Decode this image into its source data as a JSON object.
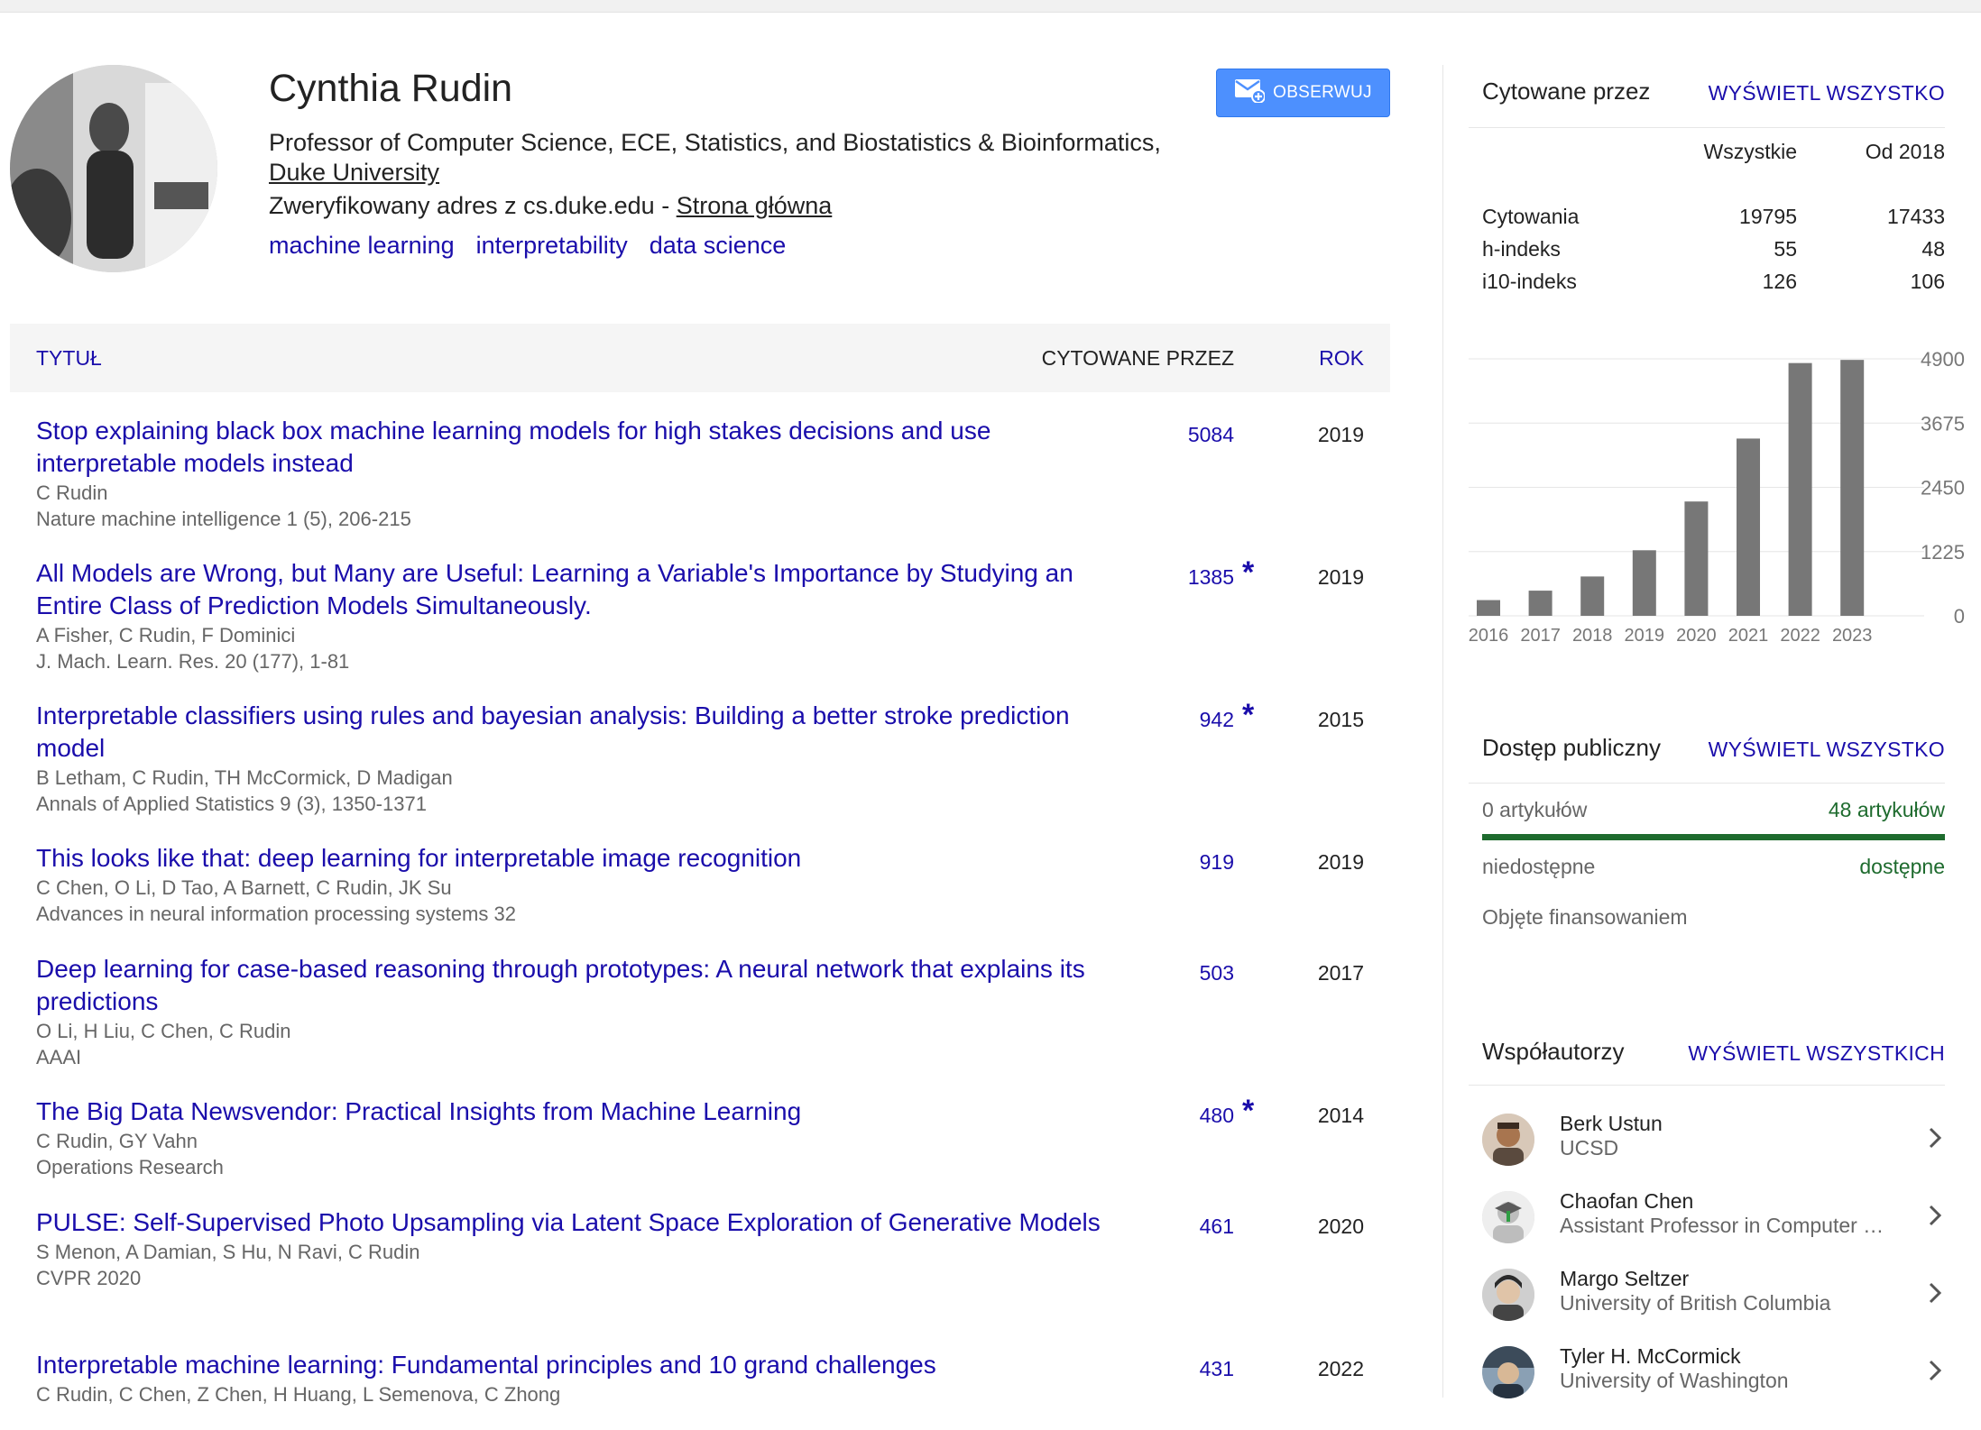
{
  "profile": {
    "name": "Cynthia Rudin",
    "affiliation_prefix": "Professor of Computer Science, ECE, Statistics, and Biostatistics & Bioinformatics,",
    "affiliation_link": "Duke University",
    "verified_text": "Zweryfikowany adres z cs.duke.edu - ",
    "homepage_link": "Strona główna",
    "interests": [
      "machine learning",
      "interpretability",
      "data science"
    ],
    "follow_label": "OBSERWUJ"
  },
  "table": {
    "col_title": "TYTUŁ",
    "col_cited": "CYTOWANE PRZEZ",
    "col_year": "ROK",
    "rows": [
      {
        "title": "Stop explaining black box machine learning models for high stakes decisions and use interpretable models instead",
        "authors": "C Rudin",
        "venue": "Nature machine intelligence 1 (5), 206-215",
        "cited": "5084",
        "star": "",
        "year": "2019"
      },
      {
        "title": "All Models are Wrong, but Many are Useful: Learning a Variable's Importance by Studying an Entire Class of Prediction Models Simultaneously.",
        "authors": "A Fisher, C Rudin, F Dominici",
        "venue": "J. Mach. Learn. Res. 20 (177), 1-81",
        "cited": "1385",
        "star": "*",
        "year": "2019"
      },
      {
        "title": "Interpretable classifiers using rules and bayesian analysis: Building a better stroke prediction model",
        "authors": "B Letham, C Rudin, TH McCormick, D Madigan",
        "venue": "Annals of Applied Statistics 9 (3), 1350-1371",
        "cited": "942",
        "star": "*",
        "year": "2015"
      },
      {
        "title": "This looks like that: deep learning for interpretable image recognition",
        "authors": "C Chen, O Li, D Tao, A Barnett, C Rudin, JK Su",
        "venue": "Advances in neural information processing systems 32",
        "cited": "919",
        "star": "",
        "year": "2019"
      },
      {
        "title": "Deep learning for case-based reasoning through prototypes: A neural network that explains its predictions",
        "authors": "O Li, H Liu, C Chen, C Rudin",
        "venue": "AAAI",
        "cited": "503",
        "star": "",
        "year": "2017"
      },
      {
        "title": "The Big Data Newsvendor: Practical Insights from Machine Learning",
        "authors": "C Rudin, GY Vahn",
        "venue": "Operations Research",
        "cited": "480",
        "star": "*",
        "year": "2014"
      },
      {
        "title": "PULSE: Self-Supervised Photo Upsampling via Latent Space Exploration of Generative Models",
        "authors": "S Menon, A Damian, S Hu, N Ravi, C Rudin",
        "venue": "CVPR 2020",
        "cited": "461",
        "star": "",
        "year": "2020"
      },
      {
        "title": "Interpretable machine learning: Fundamental principles and 10 grand challenges",
        "authors": "C Rudin, C Chen, Z Chen, H Huang, L Semenova, C Zhong",
        "venue": "",
        "cited": "431",
        "star": "",
        "year": "2022"
      }
    ]
  },
  "cited_by": {
    "heading": "Cytowane przez",
    "view_all": "WYŚWIETL WSZYSTKO",
    "col_all": "Wszystkie",
    "col_since": "Od 2018",
    "rows": [
      {
        "label": "Cytowania",
        "all": "19795",
        "since": "17433"
      },
      {
        "label": "h-indeks",
        "all": "55",
        "since": "48"
      },
      {
        "label": "i10-indeks",
        "all": "126",
        "since": "106"
      }
    ]
  },
  "chart_data": {
    "type": "bar",
    "categories": [
      "2016",
      "2017",
      "2018",
      "2019",
      "2020",
      "2021",
      "2022",
      "2023"
    ],
    "values": [
      300,
      480,
      750,
      1250,
      2180,
      3380,
      4820,
      4880
    ],
    "yticks": [
      "4900",
      "3675",
      "2450",
      "1225",
      "0"
    ],
    "ylim": [
      0,
      4900
    ],
    "bar_color": "#777777"
  },
  "open_access": {
    "heading": "Dostęp publiczny",
    "view_all": "WYŚWIETL WSZYSTKO",
    "left_count": "0 artykułów",
    "right_count": "48 artykułów",
    "left_label": "niedostępne",
    "right_label": "dostępne",
    "note": "Objęte finansowaniem",
    "accent": "#1e6b2e"
  },
  "coauthors": {
    "heading": "Współautorzy",
    "view_all": "WYŚWIETL WSZYSTKICH",
    "items": [
      {
        "name": "Berk Ustun",
        "affiliation": "UCSD"
      },
      {
        "name": "Chaofan Chen",
        "affiliation": "Assistant Professor in Computer …"
      },
      {
        "name": "Margo Seltzer",
        "affiliation": "University of British Columbia"
      },
      {
        "name": "Tyler H. McCormick",
        "affiliation": "University of Washington"
      }
    ]
  }
}
